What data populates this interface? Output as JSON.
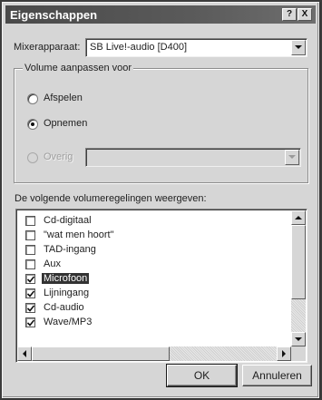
{
  "window": {
    "title": "Eigenschappen",
    "help_glyph": "?",
    "close_glyph": "X"
  },
  "mixer": {
    "label": "Mixerapparaat:",
    "value": "SB Live!-audio [D400]"
  },
  "volume_group": {
    "legend": "Volume aanpassen voor",
    "options": [
      {
        "label": "Afspelen",
        "checked": false,
        "enabled": true
      },
      {
        "label": "Opnemen",
        "checked": true,
        "enabled": true
      },
      {
        "label": "Overig",
        "checked": false,
        "enabled": false
      }
    ],
    "other_combo_value": ""
  },
  "controls_list": {
    "label": "De volgende volumeregelingen weergeven:",
    "items": [
      {
        "label": "Cd-digitaal",
        "checked": false,
        "selected": false
      },
      {
        "label": "\"wat men hoort\"",
        "checked": false,
        "selected": false
      },
      {
        "label": "TAD-ingang",
        "checked": false,
        "selected": false
      },
      {
        "label": "Aux",
        "checked": false,
        "selected": false
      },
      {
        "label": "Microfoon",
        "checked": true,
        "selected": true
      },
      {
        "label": "Lijningang",
        "checked": true,
        "selected": false
      },
      {
        "label": "Cd-audio",
        "checked": true,
        "selected": false
      },
      {
        "label": "Wave/MP3",
        "checked": true,
        "selected": false
      }
    ]
  },
  "buttons": {
    "ok": "OK",
    "cancel": "Annuleren"
  }
}
